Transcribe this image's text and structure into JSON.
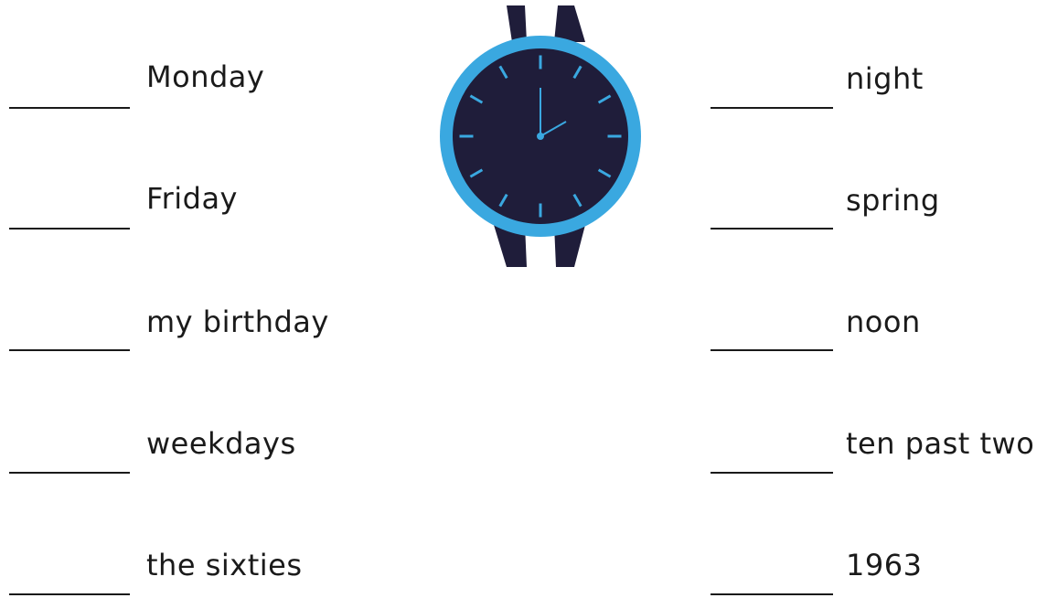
{
  "exercise": {
    "left_items": [
      {
        "text": "Monday"
      },
      {
        "text": "Friday"
      },
      {
        "text": "my birthday"
      },
      {
        "text": "weekdays"
      },
      {
        "text": "the sixties"
      }
    ],
    "right_items": [
      {
        "text": "night"
      },
      {
        "text": "spring"
      },
      {
        "text": "noon"
      },
      {
        "text": "ten past two"
      },
      {
        "text": "1963"
      }
    ]
  },
  "illustration": {
    "icon": "wristwatch-icon",
    "colors": {
      "strap": "#1f1d3a",
      "face": "#1f1d3a",
      "bezel": "#3aa8e0",
      "markers": "#3aa8e0",
      "hands": "#3aa8e0"
    }
  }
}
